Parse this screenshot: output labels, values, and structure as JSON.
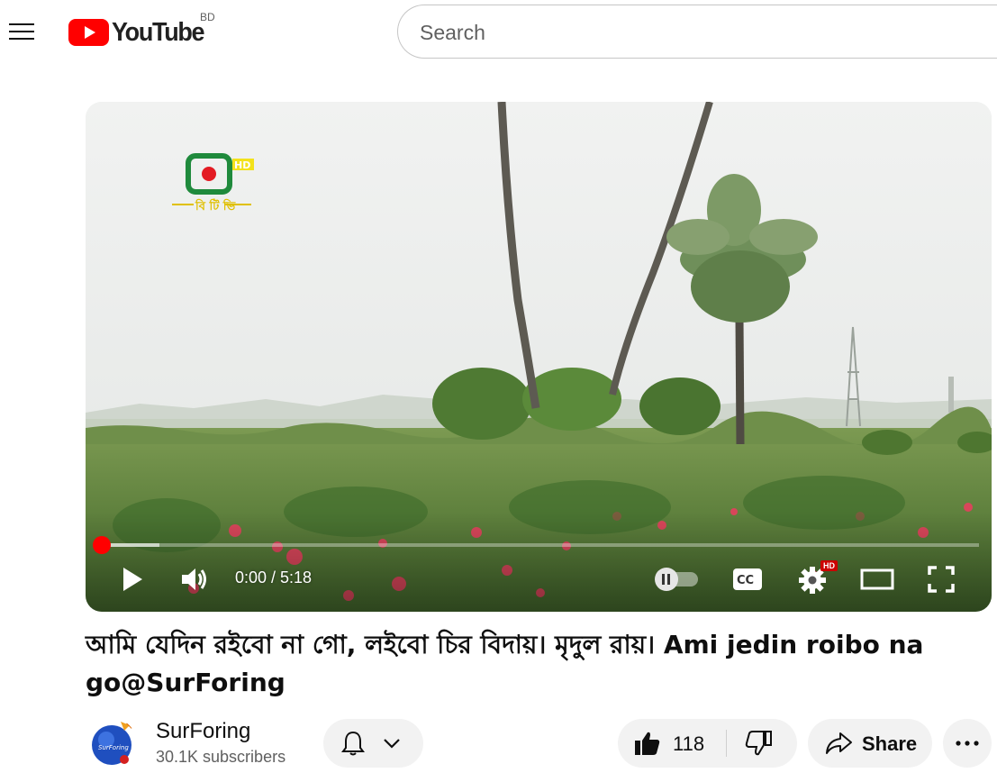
{
  "header": {
    "logo_text": "YouTube",
    "country_code": "BD",
    "search_placeholder": "Search",
    "search_value": ""
  },
  "player": {
    "channel_bug_text": "বি টি ভি",
    "channel_bug_hd": "HD",
    "current_time": "0:00",
    "duration": "5:18",
    "time_display": "0:00 / 5:18",
    "played_fraction": 0.0,
    "buffered_fraction": 0.07,
    "quality_badge": "HD",
    "autoplay_on": false,
    "icons": [
      "play-icon",
      "volume-icon",
      "autoplay-toggle-icon",
      "captions-icon",
      "settings-icon",
      "theater-mode-icon",
      "fullscreen-icon"
    ]
  },
  "video": {
    "title": "আমি যেদিন রইবো না গো, লইবো চির বিদায়। মৃদুল রায়। Ami jedin roibo na go@SurForing"
  },
  "owner": {
    "channel_name": "SurForing",
    "subscribers": "30.1K subscribers",
    "avatar_text": "SurForing"
  },
  "actions": {
    "like_count": "118",
    "share_label": "Share"
  },
  "colors": {
    "brand_red": "#ff0000",
    "pill_bg": "#f2f2f2",
    "text": "#0f0f0f",
    "muted": "#606060"
  }
}
